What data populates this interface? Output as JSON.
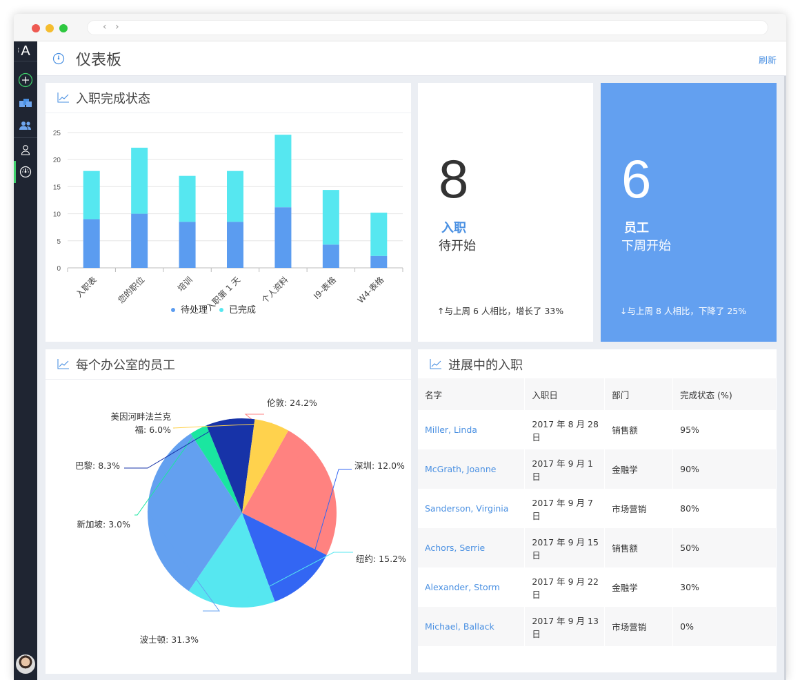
{
  "header": {
    "title": "仪表板",
    "refresh_label": "刷新"
  },
  "sidebar": {
    "logo": "A",
    "items": [
      {
        "icon": "add-circle-icon"
      },
      {
        "icon": "folders-icon"
      },
      {
        "icon": "people-icon"
      },
      {
        "icon": "person-icon"
      },
      {
        "icon": "dashboard-gauge-icon",
        "active": true
      }
    ]
  },
  "bar_card": {
    "title": "入职完成状态"
  },
  "stat_card_1": {
    "number": "8",
    "label_line1": "入职",
    "label_line2": "待开始",
    "change": "↑与上周 6 人相比，增长了 33%"
  },
  "stat_card_2": {
    "number": "6",
    "label_line1": "员工",
    "label_line2": "下周开始",
    "change": "↓与上周 8 人相比，下降了 25%"
  },
  "pie_card": {
    "title": "每个办公室的员工"
  },
  "table_card": {
    "title": "进展中的入职",
    "columns": [
      "名字",
      "入职日",
      "部门",
      "完成状态 (%)"
    ],
    "rows": [
      [
        "Miller, Linda",
        "2017 年 8 月 28 日",
        "销售额",
        "95%"
      ],
      [
        "McGrath, Joanne",
        "2017 年 9 月 1 日",
        "金融学",
        "90%"
      ],
      [
        "Sanderson, Virginia",
        "2017 年 9 月 7 日",
        "市场营销",
        "80%"
      ],
      [
        "Achors, Serrie",
        "2017 年 9 月 15 日",
        "销售额",
        "50%"
      ],
      [
        "Alexander, Storm",
        "2017 年 9 月 22 日",
        "金融学",
        "30%"
      ],
      [
        "Michael, Ballack",
        "2017 年 9 月 13 日",
        "市场营销",
        "0%"
      ]
    ]
  },
  "colors": {
    "accent": "#4a90e2",
    "sidebar": "#1f2532",
    "stat_card_bg": "#63a0f0",
    "active_green": "#3ecf6b"
  },
  "chart_data": [
    {
      "type": "bar",
      "stacked": true,
      "categories": [
        "入职表",
        "您的职位",
        "培训",
        "入职第 1 天",
        "个人资料",
        "I9-表格",
        "W4-表格"
      ],
      "series": [
        {
          "name": "待处理",
          "color": "#5b9cf0",
          "values": [
            9,
            10,
            8.5,
            8.5,
            11.2,
            4.3,
            2.2
          ]
        },
        {
          "name": "已完成",
          "color": "#56e7f0",
          "values": [
            8.9,
            12.2,
            8.5,
            9.4,
            13.4,
            10.1,
            8.0
          ]
        }
      ],
      "ylim": [
        0,
        25
      ],
      "yticks": [
        0,
        5,
        10,
        15,
        20,
        25
      ],
      "grid": true,
      "legend": "bottom"
    },
    {
      "type": "pie",
      "slices": [
        {
          "label": "伦敦",
          "value": 24.2,
          "display": "伦敦: 24.2%",
          "color": "#ff8280"
        },
        {
          "label": "深圳",
          "value": 12.0,
          "display": "深圳: 12.0%",
          "color": "#3366f3"
        },
        {
          "label": "纽约",
          "value": 15.2,
          "display": "纽约: 15.2%",
          "color": "#56e7f0"
        },
        {
          "label": "波士顿",
          "value": 31.3,
          "display": "波士顿: 31.3%",
          "color": "#63a0f0"
        },
        {
          "label": "新加坡",
          "value": 3.0,
          "display": "新加坡: 3.0%",
          "color": "#1ae6a0"
        },
        {
          "label": "巴黎",
          "value": 8.3,
          "display": "巴黎: 8.3%",
          "color": "#1733a8"
        },
        {
          "label": "美因河畔法兰克福",
          "value": 6.0,
          "display_lines": [
            "美因河畔法兰克",
            "福: 6.0%"
          ],
          "color": "#ffd24d"
        }
      ]
    }
  ]
}
